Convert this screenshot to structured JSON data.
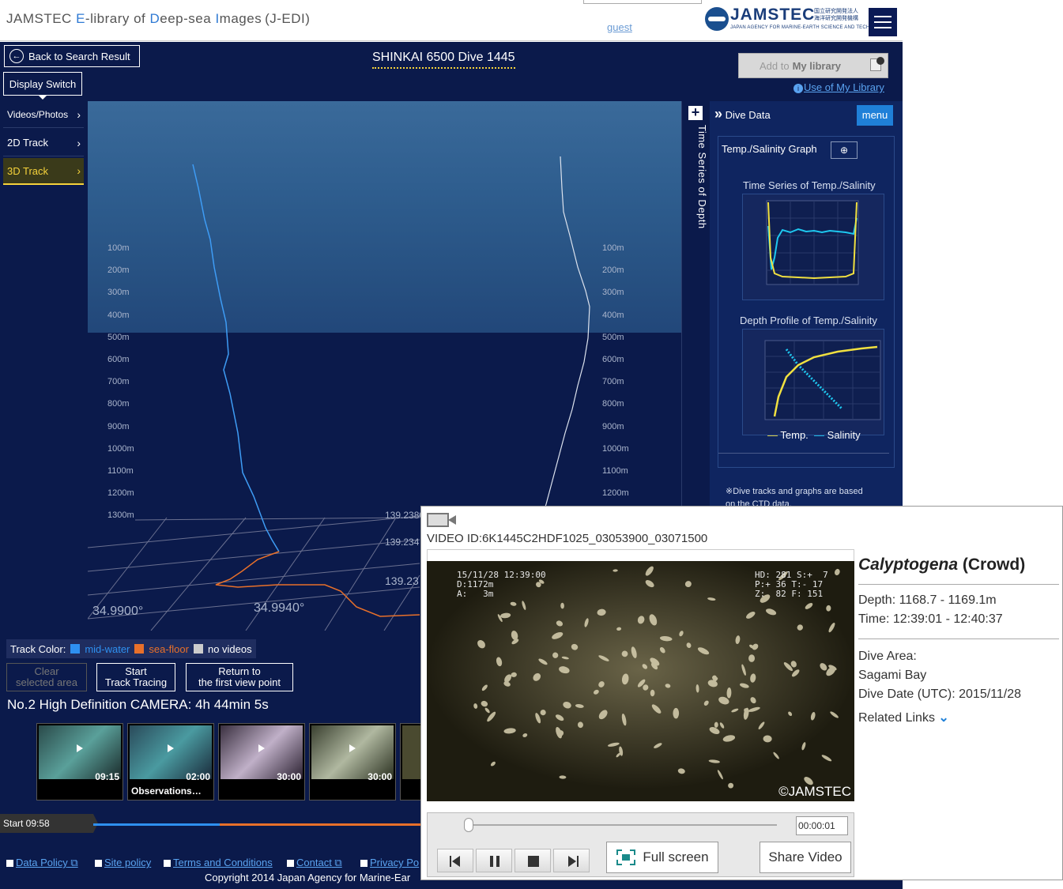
{
  "header": {
    "title_parts": [
      "JAMSTEC ",
      "E",
      "-library of ",
      "D",
      "eep-sea ",
      "I",
      "mages (J-EDI)"
    ],
    "guest": "guest",
    "logo_text": "JAMSTEC",
    "logo_jp": "国立研究開発法人 海洋研究開発機構",
    "logo_sub": "JAPAN AGENCY FOR MARINE-EARTH SCIENCE AND TECHNOLOGY"
  },
  "toolbar": {
    "back": "Back to Search Result",
    "dive_title": "SHINKAI 6500 Dive 1445",
    "add_library": "Add to",
    "add_library_bold": "My library",
    "use_library": "Use of My Library"
  },
  "sidebar": {
    "display_switch": "Display Switch",
    "items": [
      {
        "label": "Videos/Photos",
        "active": false
      },
      {
        "label": "2D Track",
        "active": false
      },
      {
        "label": "3D Track",
        "active": true
      }
    ]
  },
  "viz": {
    "depth_labels": [
      "100m",
      "200m",
      "300m",
      "400m",
      "500m",
      "600m",
      "700m",
      "800m",
      "900m",
      "1000m",
      "1100m",
      "1200m",
      "1300m"
    ],
    "right_depth_labels": [
      "100m",
      "200m",
      "300m",
      "400m",
      "500m",
      "600m",
      "700m",
      "800m",
      "900m",
      "1000m",
      "1100m",
      "1200m"
    ],
    "lon_labels": [
      "34.9900°",
      "34.9940°"
    ],
    "lat_labels": [
      "139.2380",
      "139.234",
      "139.23"
    ]
  },
  "time_series_panel": {
    "label": "Time Series of Depth"
  },
  "right_panel": {
    "header": "Dive Data",
    "menu": "menu",
    "graph_label": "Temp./Salinity Graph",
    "graph1_title": "Time Series of Temp./Salinity",
    "graph2_title": "Depth Profile of Temp./Salinity",
    "legend_temp": "Temp.",
    "legend_sal": "Salinity",
    "note": "※Dive tracks and graphs are based on the CTD data."
  },
  "track_color": {
    "label": "Track Color:",
    "mid": "mid-water",
    "floor": "sea-floor",
    "none": "no videos",
    "colors": {
      "mid": "#2e90f0",
      "floor": "#e8702a",
      "none": "#cccccc"
    }
  },
  "track_buttons": {
    "clear": [
      "Clear",
      "selected area"
    ],
    "start": [
      "Start",
      "Track Tracing"
    ],
    "return": [
      "Return to",
      "the first view point"
    ]
  },
  "camera": {
    "title": "No.2 High Definition CAMERA: 4h 44min 5s",
    "thumbs": [
      {
        "time": "09:15",
        "caption": ""
      },
      {
        "time": "02:00",
        "caption": "Observations…"
      },
      {
        "time": "30:00",
        "caption": ""
      },
      {
        "time": "30:00",
        "caption": ""
      }
    ]
  },
  "timeline": {
    "start": "Start 09:58"
  },
  "footer": {
    "links": [
      "Data Policy",
      "Site policy",
      "Terms and Conditions",
      "Contact",
      "Privacy Po"
    ],
    "copyright": "Copyright 2014 Japan Agency for Marine-Ear"
  },
  "video_popup": {
    "video_id": "VIDEO ID:6K1445C2HDF1025_03053900_03071500",
    "osd_left": "15/11/28 12:39:00\nD:1172m\nA:   3m",
    "osd_right": "HD: 281 S:+  7\nP:+ 36 T:- 17\nZ:  82 F: 151",
    "watermark": "©JAMSTEC",
    "time_value": "00:00:01",
    "fullscreen": "Full screen",
    "share": "Share Video",
    "species": "Calyptogena",
    "species_note": "(Crowd)",
    "depth": "Depth: 1168.7 - 1169.1m",
    "time": "Time: 12:39:01 - 12:40:37",
    "area_label": "Dive Area:",
    "area": "Sagami Bay",
    "date": "Dive Date (UTC): 2015/11/28",
    "related": "Related Links"
  }
}
